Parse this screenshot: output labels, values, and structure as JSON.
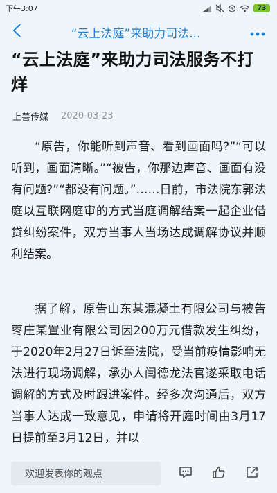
{
  "status_bar": {
    "time": "下午3:07",
    "battery": "73"
  },
  "nav": {
    "title": "“云上法庭”来助力司法..."
  },
  "article": {
    "title": "“云上法庭”来助力司法服务不打烊",
    "author": "上善传媒",
    "date": "2020-03-23",
    "paragraphs": [
      "“原告，你能听到声音、看到画面吗?”“可以听到，画面清晰。”“被告，你那边声音、画面有没有问题?”“都没有问题。”……日前，市法院东郭法庭以互联网庭审的方式当庭调解结案一起企业借贷纠纷案件，双方当事人当场达成调解协议并顺利结案。",
      "据了解，原告山东某混凝土有限公司与被告枣庄某置业有限公司因200万元借款发生纠纷，于2020年2月27日诉至法院，受当前疫情影响无法进行现场调解，承办人闫德龙法官遂采取电话调解的方式及时跟进案件。经多次沟通后，双方当事人达成一致意见，申请将开庭时间由3月17日提前至3月12日，并以"
    ]
  },
  "bottom_bar": {
    "comment_placeholder": "欢迎发表你的观点"
  },
  "colors": {
    "accent": "#1e7fd6",
    "background": "#eef5fb",
    "battery": "#79c52b"
  },
  "icons": {
    "status": [
      "signal-icon",
      "mute-icon",
      "alarm-icon",
      "wifi-icon"
    ],
    "nav": [
      "back-chevron-icon",
      "more-dots-icon"
    ],
    "actions": [
      "comment-icon",
      "like-icon",
      "share-icon"
    ]
  }
}
